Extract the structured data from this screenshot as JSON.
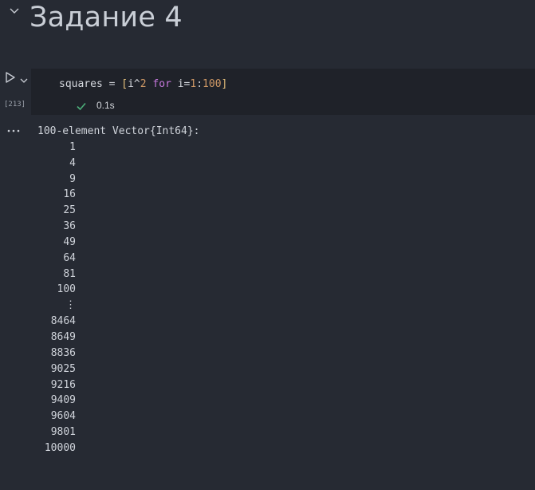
{
  "markdown_cell": {
    "heading": "Задание 4"
  },
  "code_cell": {
    "execution_count": "[213]",
    "code_tokens": {
      "var": "squares",
      "assign": " = ",
      "open_bracket": "[",
      "expr": "i^",
      "exp": "2",
      "space1": " ",
      "keyword": "for",
      "loop_var": " i=",
      "start": "1",
      "colon": ":",
      "end": "100",
      "close_bracket": "]"
    },
    "status": "success",
    "execution_time": "0.1s"
  },
  "output": {
    "header": "100-element Vector{Int64}:",
    "values": [
      "1",
      "4",
      "9",
      "16",
      "25",
      "36",
      "49",
      "64",
      "81",
      "100",
      "⋮",
      "8464",
      "8649",
      "8836",
      "9025",
      "9216",
      "9409",
      "9604",
      "9801",
      "10000"
    ]
  },
  "icons": {
    "collapse": "chevron-down-icon",
    "run": "play-icon",
    "run_menu": "chevron-down-icon",
    "success": "check-icon",
    "output_menu": "ellipsis-icon"
  },
  "colors": {
    "background": "#262a33",
    "editor_background": "#1f2229",
    "success": "#4caf7a",
    "keyword": "#c678dd",
    "number": "#d19a66",
    "bracket": "#e5c07b"
  }
}
